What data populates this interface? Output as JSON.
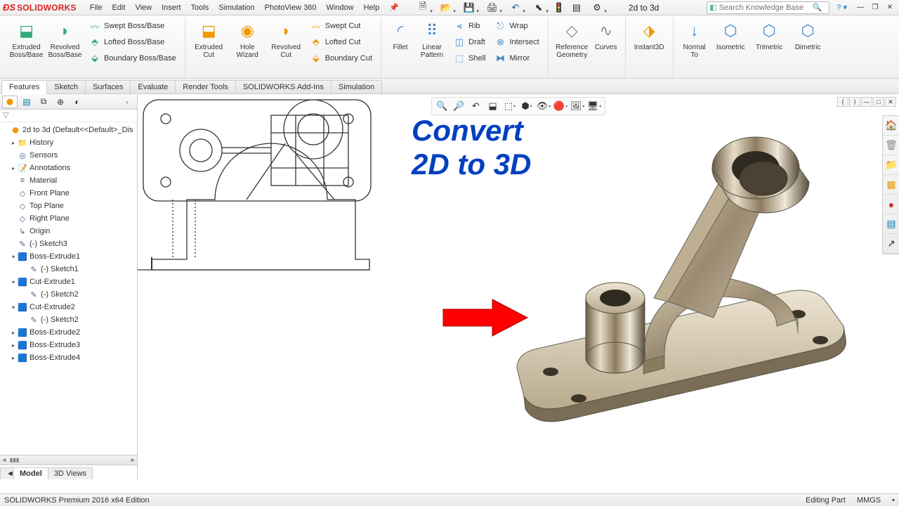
{
  "app": {
    "logo_text": "SOLIDWORKS",
    "doc_name": "2d to 3d"
  },
  "menu": [
    "File",
    "Edit",
    "View",
    "Insert",
    "Tools",
    "Simulation",
    "PhotoView 360",
    "Window",
    "Help"
  ],
  "search": {
    "placeholder": "Search Knowledge Base"
  },
  "ribbon": {
    "tabs": [
      "Features",
      "Sketch",
      "Surfaces",
      "Evaluate",
      "Render Tools",
      "SOLIDWORKS Add-Ins",
      "Simulation"
    ],
    "active_tab": 0,
    "groups": {
      "extrude_boss": "Extruded Boss/Base",
      "revolve_boss": "Revolved Boss/Base",
      "swept_boss": "Swept Boss/Base",
      "lofted_boss": "Lofted Boss/Base",
      "boundary_boss": "Boundary Boss/Base",
      "extruded_cut": "Extruded Cut",
      "hole_wizard": "Hole Wizard",
      "revolved_cut": "Revolved Cut",
      "swept_cut": "Swept Cut",
      "lofted_cut": "Lofted Cut",
      "boundary_cut": "Boundary Cut",
      "fillet": "Fillet",
      "linear_pattern": "Linear Pattern",
      "rib": "Rib",
      "draft": "Draft",
      "shell": "Shell",
      "wrap": "Wrap",
      "intersect": "Intersect",
      "mirror": "Mirror",
      "ref_geom": "Reference Geometry",
      "curves": "Curves",
      "instant3d": "Instant3D",
      "normal_to": "Normal To",
      "isometric": "Isometric",
      "trimetric": "Trimetric",
      "dimetric": "Dimetric"
    }
  },
  "tree": {
    "root": "2d to 3d  (Default<<Default>_Dis",
    "items": [
      {
        "label": "History",
        "icon": "📁",
        "tw": "▸",
        "indent": 1
      },
      {
        "label": "Sensors",
        "icon": "◎",
        "tw": "",
        "indent": 1
      },
      {
        "label": "Annotations",
        "icon": "📝",
        "tw": "▸",
        "indent": 1
      },
      {
        "label": "Material <not specified>",
        "icon": "≡",
        "tw": "",
        "indent": 1
      },
      {
        "label": "Front Plane",
        "icon": "◇",
        "tw": "",
        "indent": 1
      },
      {
        "label": "Top Plane",
        "icon": "◇",
        "tw": "",
        "indent": 1
      },
      {
        "label": "Right Plane",
        "icon": "◇",
        "tw": "",
        "indent": 1
      },
      {
        "label": "Origin",
        "icon": "↳",
        "tw": "",
        "indent": 1
      },
      {
        "label": "(-) Sketch3",
        "icon": "✎",
        "tw": "",
        "indent": 1
      },
      {
        "label": "Boss-Extrude1",
        "icon": "🟦",
        "tw": "▾",
        "indent": 1,
        "color": "#2b7"
      },
      {
        "label": "(-) Sketch1",
        "icon": "✎",
        "tw": "",
        "indent": 2
      },
      {
        "label": "Cut-Extrude1",
        "icon": "🟦",
        "tw": "▾",
        "indent": 1,
        "color": "#e84"
      },
      {
        "label": "(-) Sketch2",
        "icon": "✎",
        "tw": "",
        "indent": 2
      },
      {
        "label": "Cut-Extrude2",
        "icon": "🟦",
        "tw": "▾",
        "indent": 1,
        "color": "#e84"
      },
      {
        "label": "(-) Sketch2",
        "icon": "✎",
        "tw": "",
        "indent": 2
      },
      {
        "label": "Boss-Extrude2",
        "icon": "🟦",
        "tw": "▸",
        "indent": 1,
        "color": "#2b7"
      },
      {
        "label": "Boss-Extrude3",
        "icon": "🟦",
        "tw": "▸",
        "indent": 1,
        "color": "#2b7"
      },
      {
        "label": "Boss-Extrude4",
        "icon": "🟦",
        "tw": "▸",
        "indent": 1,
        "color": "#2b7"
      }
    ],
    "bottom_tabs": [
      "Model",
      "3D Views"
    ]
  },
  "banner": {
    "line1": "Convert",
    "line2": "2D to 3D"
  },
  "status": {
    "edition": "SOLIDWORKS Premium 2016 x64 Edition",
    "mode": "Editing Part",
    "units": "MMGS"
  },
  "colors": {
    "accent": "#d22",
    "banner": "#0040c0",
    "arrow": "#ff0000"
  }
}
